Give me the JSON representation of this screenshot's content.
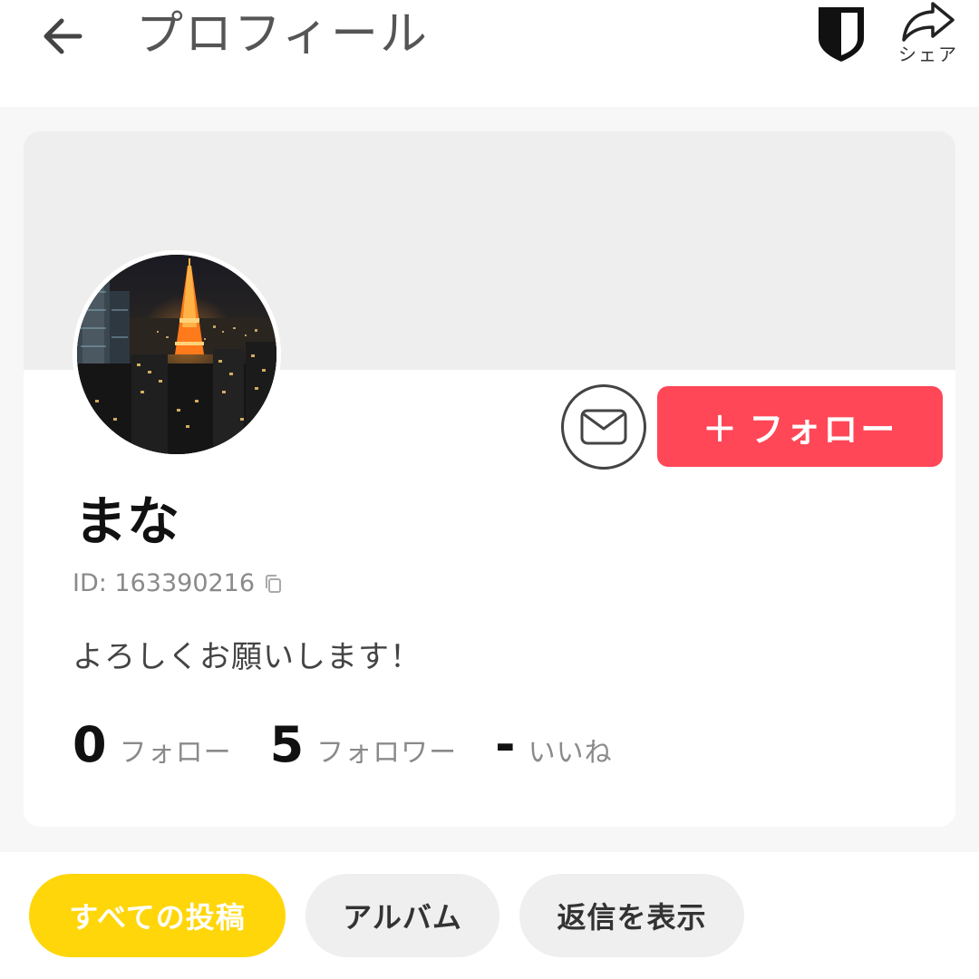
{
  "header": {
    "title": "プロフィール",
    "back_icon": "arrow-left-icon",
    "shield_icon": "shield-icon",
    "share_icon": "share-arrow-icon",
    "share_label": "シェア"
  },
  "profile": {
    "name": "まな",
    "id_text": "ID: 163390216",
    "bio": "よろしくお願いします！",
    "avatar_description_icon": "tokyo-tower-night-avatar"
  },
  "actions": {
    "mail_icon": "mail-icon",
    "follow_plus": "+",
    "follow_label": "フォロー"
  },
  "stats": [
    {
      "value": "0",
      "label": "フォロー"
    },
    {
      "value": "5",
      "label": "フォロワー"
    },
    {
      "value": "-",
      "label": "いいね"
    }
  ],
  "tabs": [
    {
      "label": "すべての投稿",
      "active": true
    },
    {
      "label": "アルバム",
      "active": false
    },
    {
      "label": "返信を表示",
      "active": false
    }
  ],
  "colors": {
    "follow_button": "#ff4757",
    "active_chip": "#ffd60a",
    "inactive_chip": "#efefef"
  }
}
